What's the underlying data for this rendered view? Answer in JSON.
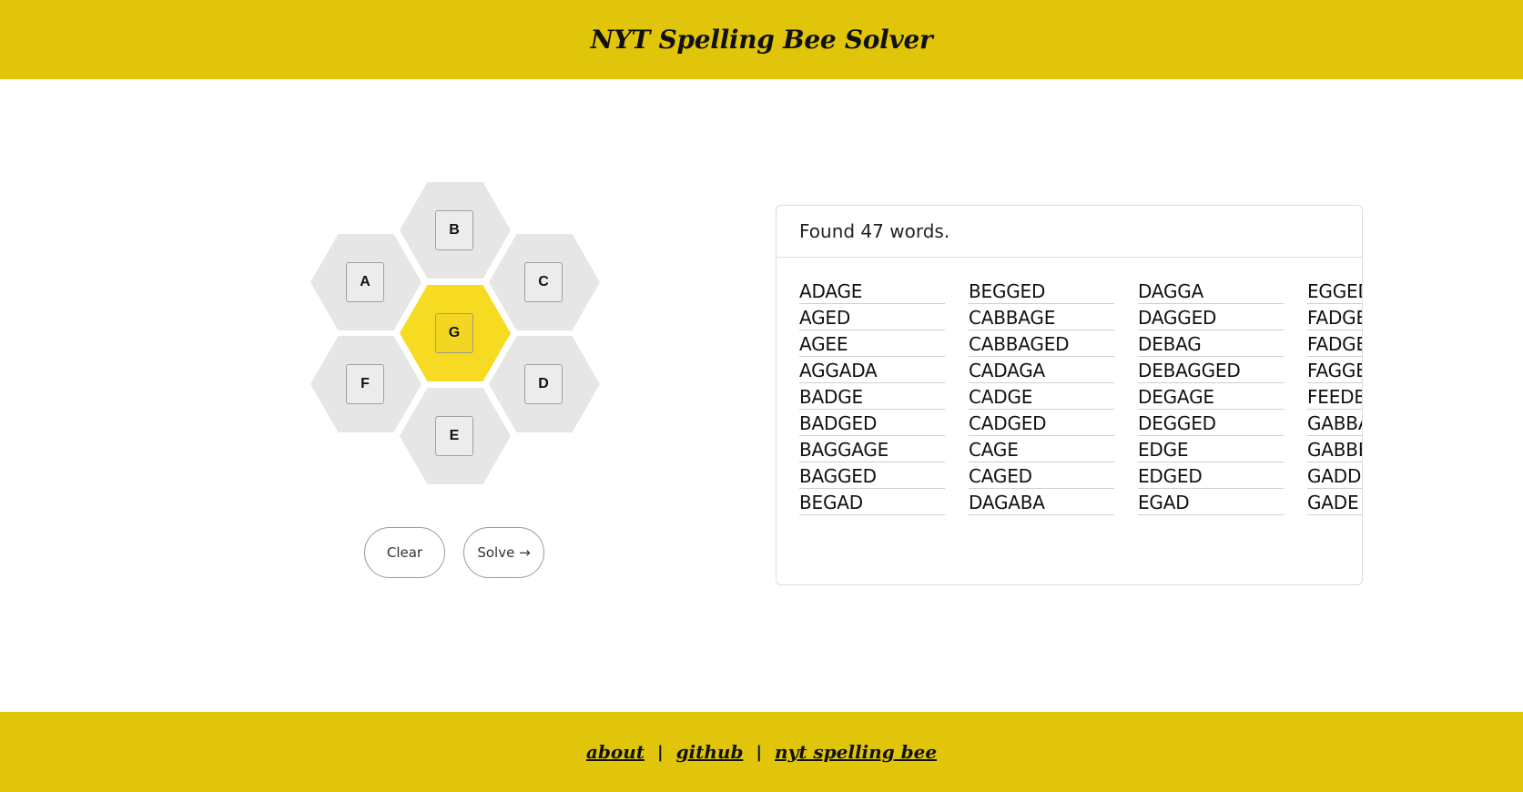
{
  "header": {
    "title": "NYT Spelling Bee Solver"
  },
  "hive": {
    "center_letter": "G",
    "outer_letters": {
      "top": "B",
      "upper_left": "A",
      "upper_right": "C",
      "lower_left": "F",
      "lower_right": "D",
      "bottom": "E"
    },
    "center_color": "#f7da22",
    "outer_color": "#e6e6e6"
  },
  "buttons": {
    "clear_label": "Clear",
    "solve_label": "Solve →"
  },
  "results": {
    "summary": "Found 47 words.",
    "columns": [
      [
        "ADAGE",
        "AGED",
        "AGEE",
        "AGGADA",
        "BADGE",
        "BADGED",
        "BAGGAGE",
        "BAGGED",
        "BEGAD"
      ],
      [
        "BEGGED",
        "CABBAGE",
        "CABBAGED",
        "CADAGA",
        "CADGE",
        "CADGED",
        "CAGE",
        "CAGED",
        "DAGABA"
      ],
      [
        "DAGGA",
        "DAGGED",
        "DEBAG",
        "DEBAGGED",
        "DEGAGE",
        "DEGGED",
        "EDGE",
        "EDGED",
        "EGAD"
      ],
      [
        "EGGED",
        "FADGE",
        "FADGE",
        "FAGGE",
        "FEEDBA",
        "GABBA",
        "GABBE",
        "GADDI",
        "GADE"
      ]
    ]
  },
  "footer": {
    "about": "about",
    "github": "github",
    "nyt": "nyt spelling bee",
    "separator": "|"
  },
  "colors": {
    "brand": "#e0c50a"
  }
}
